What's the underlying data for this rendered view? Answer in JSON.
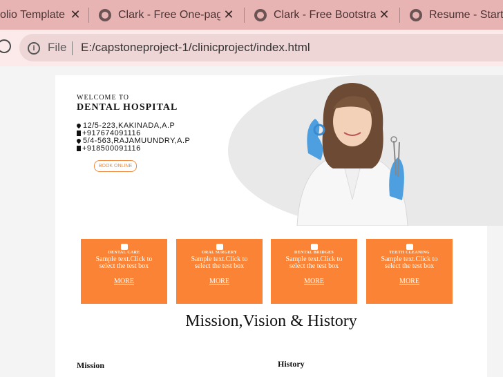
{
  "browser": {
    "tabs": [
      {
        "title": "olio Templates",
        "icon": "none"
      },
      {
        "title": "Clark - Free One-page",
        "icon": "globe-icon"
      },
      {
        "title": "Clark - Free Bootstrap",
        "icon": "globe-icon"
      },
      {
        "title": "Resume - Start B",
        "icon": "globe-icon"
      }
    ],
    "close_glyph": "✕",
    "file_label": "File",
    "url": "E:/capstoneproject-1/clinicproject/index.html"
  },
  "hero": {
    "welcome": "WELCOME TO",
    "title": "DENTAL HOSPITAL",
    "contacts": [
      {
        "icon": "location-icon",
        "text": "12/5-223,KAKINADA,A.P"
      },
      {
        "icon": "phone-icon",
        "text": "+917674091116"
      },
      {
        "icon": "location-icon",
        "text": "5/4-563,RAJAMUUNDRY,A.P"
      },
      {
        "icon": "phone-icon",
        "text": "+918500091116"
      }
    ],
    "book_label": "BOOK ONLINE"
  },
  "cards": [
    {
      "title": "DENTAL CARE",
      "text": "Sample text.Click to select the test box",
      "more": "MORE"
    },
    {
      "title": "ORAL SURGERY",
      "text": "Sample text.Click to select the test box",
      "more": "MORE"
    },
    {
      "title": "DENTAL BRIDGES",
      "text": "Sample text.Click to select the test box",
      "more": "MORE"
    },
    {
      "title": "TEETH CLEANING",
      "text": "Sample text.Click to select the test box",
      "more": "MORE"
    }
  ],
  "section": {
    "heading": "Mission,Vision & History",
    "mission": "Mission",
    "history": "History"
  },
  "colors": {
    "accent": "#fa8336",
    "tabbar": "#e8b4b3"
  }
}
